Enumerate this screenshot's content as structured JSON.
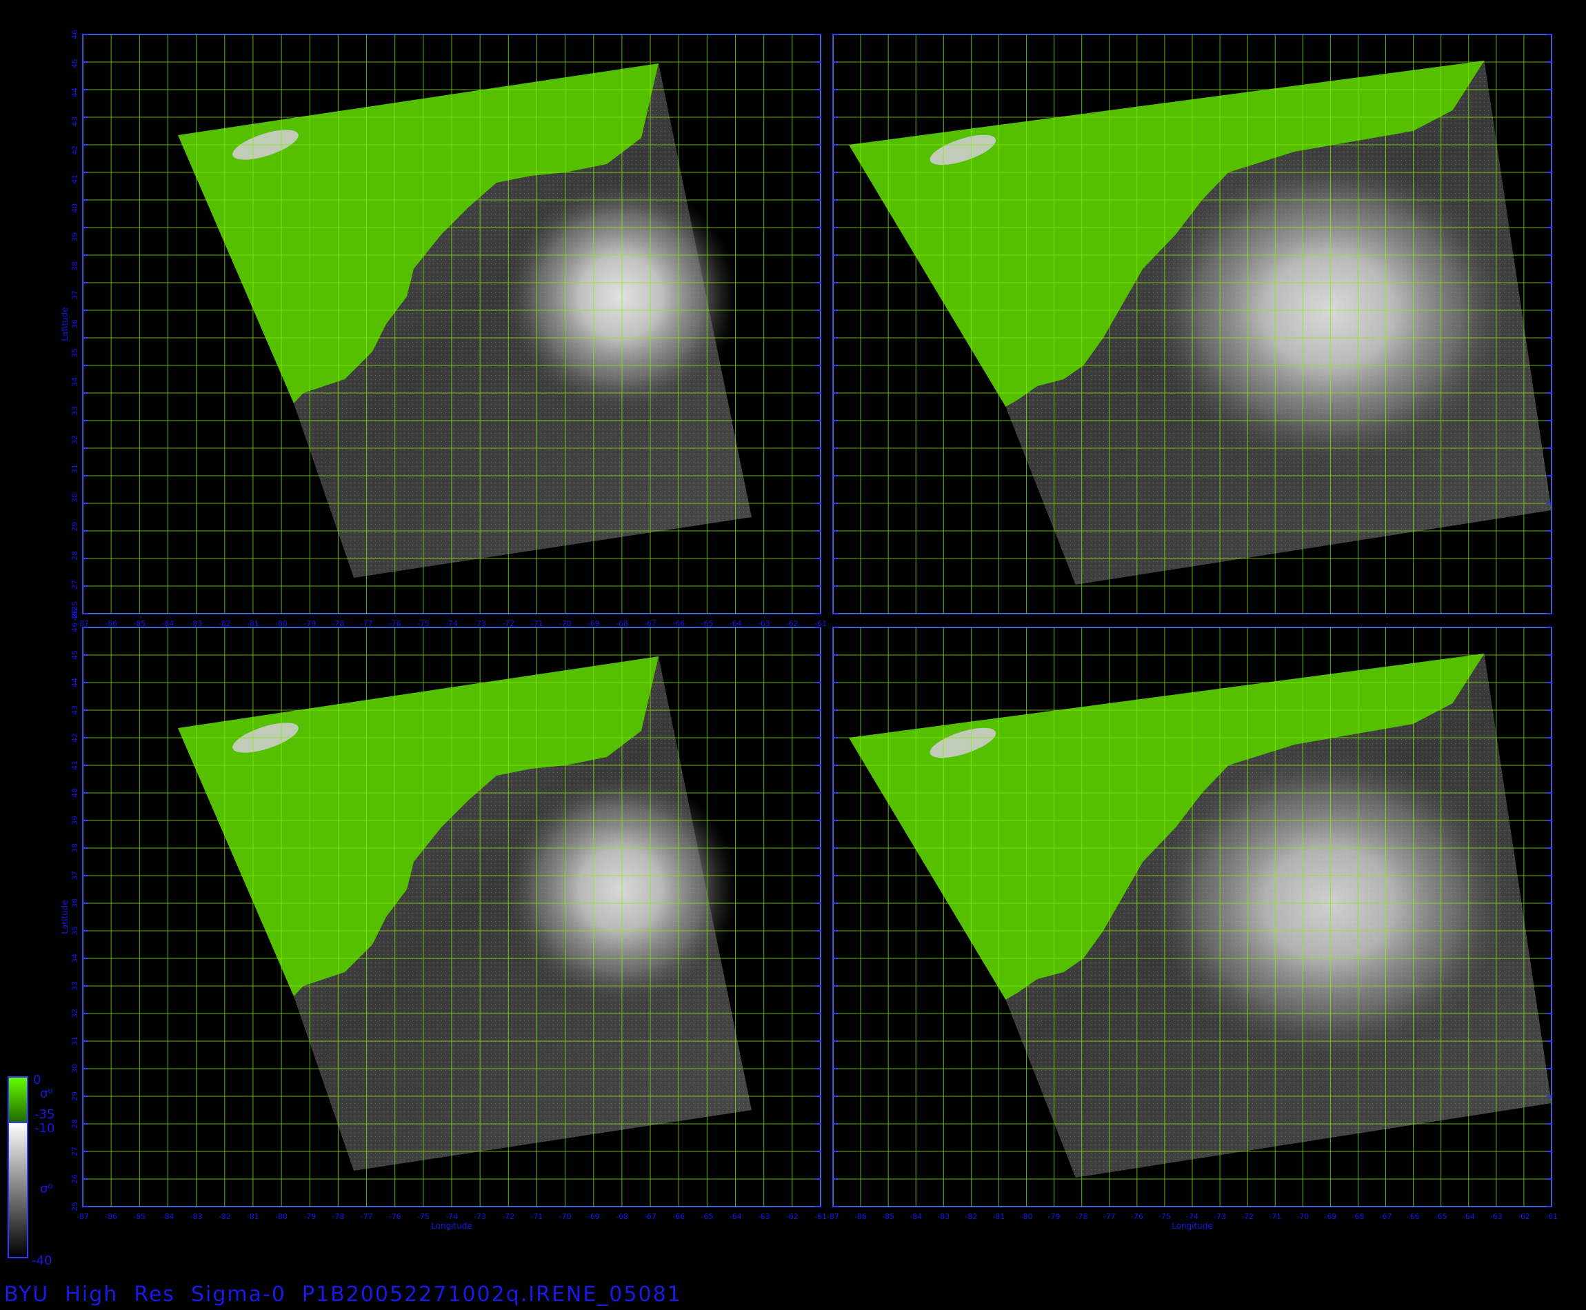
{
  "footer_title": "BYU  High  Res  Sigma-0  P1B20052271002q.IRENE_05081",
  "colors": {
    "frame": "#2a3cff",
    "grid": "#88f000",
    "land": "#55c000",
    "axis_text": "#1818e6"
  },
  "panels": [
    {
      "id": "top-left",
      "lon_ticks": [
        "-87",
        "-86",
        "-85",
        "-84",
        "-83",
        "-82",
        "-81",
        "-80",
        "-79",
        "-78",
        "-77",
        "-76",
        "-75",
        "-74",
        "-73",
        "-72",
        "-71",
        "-70",
        "-69",
        "-68",
        "-67",
        "-66",
        "-65",
        "-64",
        "-63",
        "-62",
        "-61"
      ],
      "lat_ticks": [
        "26",
        "27",
        "28",
        "29",
        "30",
        "31",
        "32",
        "33",
        "34",
        "35",
        "36",
        "37",
        "38",
        "39",
        "40",
        "41",
        "42",
        "43",
        "44",
        "45",
        "46"
      ],
      "y_label": "Latitude",
      "x_label": "",
      "corner_label": "4625",
      "storm": {
        "intensity": 0.9
      }
    },
    {
      "id": "top-right",
      "lon_ticks": [],
      "lat_ticks": [],
      "y_label": "",
      "x_label": "",
      "corner_label": "",
      "storm": {
        "intensity": 0.85
      }
    },
    {
      "id": "bottom-left",
      "lon_ticks": [
        "-87",
        "-86",
        "-85",
        "-84",
        "-83",
        "-82",
        "-81",
        "-80",
        "-79",
        "-78",
        "-77",
        "-76",
        "-75",
        "-74",
        "-73",
        "-72",
        "-71",
        "-70",
        "-69",
        "-68",
        "-67",
        "-66",
        "-65",
        "-64",
        "-63",
        "-62",
        "-61"
      ],
      "lat_ticks": [
        "25",
        "26",
        "27",
        "28",
        "29",
        "30",
        "31",
        "32",
        "33",
        "34",
        "35",
        "36",
        "37",
        "38",
        "39",
        "40",
        "41",
        "42",
        "43",
        "44",
        "45",
        "46"
      ],
      "y_label": "Latitude",
      "x_label": "Longitude",
      "corner_label": "",
      "storm": {
        "intensity": 0.85
      }
    },
    {
      "id": "bottom-right",
      "lon_ticks": [
        "-87",
        "-86",
        "-85",
        "-84",
        "-83",
        "-82",
        "-81",
        "-80",
        "-79",
        "-78",
        "-77",
        "-76",
        "-75",
        "-74",
        "-73",
        "-72",
        "-71",
        "-70",
        "-69",
        "-68",
        "-67",
        "-66",
        "-65",
        "-64",
        "-63",
        "-62",
        "-61"
      ],
      "lat_ticks": [],
      "y_label": "",
      "x_label": "Longitude",
      "corner_label": "",
      "storm": {
        "intensity": 0.8
      }
    }
  ],
  "colorbar": {
    "land_top": "0",
    "land_bottom": "-35",
    "land_symbol": "σ⁰",
    "ocean_top": "-10",
    "ocean_bottom": "-40",
    "ocean_symbol": "σ⁰"
  }
}
